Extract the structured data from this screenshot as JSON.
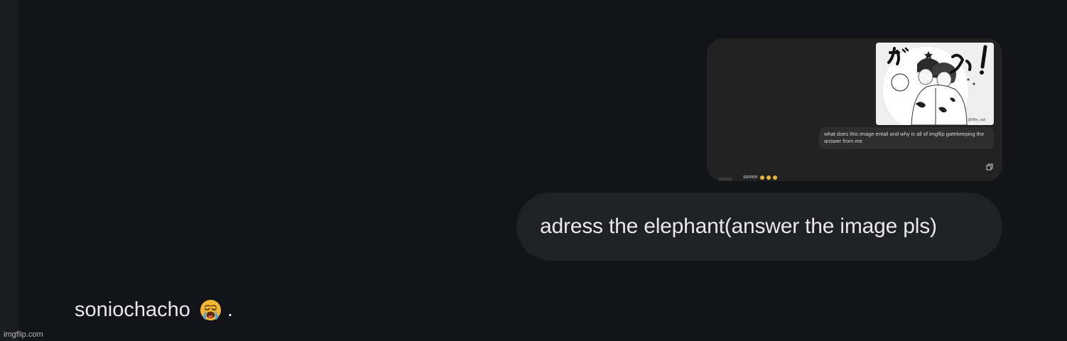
{
  "attachment": {
    "image_text_top": "が ばっ!",
    "image_bubble_text": "くっ",
    "image_credit": "@little_salt",
    "caption": "what does this image entail and why is all of imgflip gatekeeping the answer from me",
    "reply_text": "sonion",
    "reply_emoji_count": 3,
    "copy_icon": "copy-icon"
  },
  "user_message": {
    "text": "adress the elephant(answer the image pls)"
  },
  "assistant_reply": {
    "text": "soniochacho",
    "emoji": "loudly-crying-face-icon",
    "suffix": "."
  },
  "watermark": "imgflip.com",
  "colors": {
    "background": "#131419",
    "bubble": "#202128",
    "attachment": "#222222",
    "text": "#e8e8ea"
  }
}
